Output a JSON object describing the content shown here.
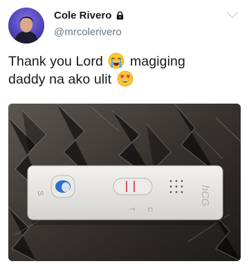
{
  "tweet": {
    "author": {
      "display_name": "Cole Rivero",
      "handle": "@mrcolerivero",
      "avatar_icon": "profile-photo",
      "protected_icon": "lock-icon"
    },
    "menu_icon": "chevron-down-icon",
    "text": {
      "part1": "Thank you Lord",
      "emoji1": "loudly-crying-face",
      "part2": "magiging",
      "part3": "daddy na ako ulit",
      "emoji2": "smiling-face-with-heart-eyes"
    },
    "media": {
      "kind": "photo",
      "subject": "pregnancy-test",
      "device_labels": {
        "sample_letter": "S",
        "control_letter": "C",
        "test_letter": "T",
        "brand": "hCG"
      }
    }
  },
  "colors": {
    "name": "#14171a",
    "handle": "#657786",
    "chevron": "#ccd6dd",
    "test_line": "#d8424f"
  }
}
